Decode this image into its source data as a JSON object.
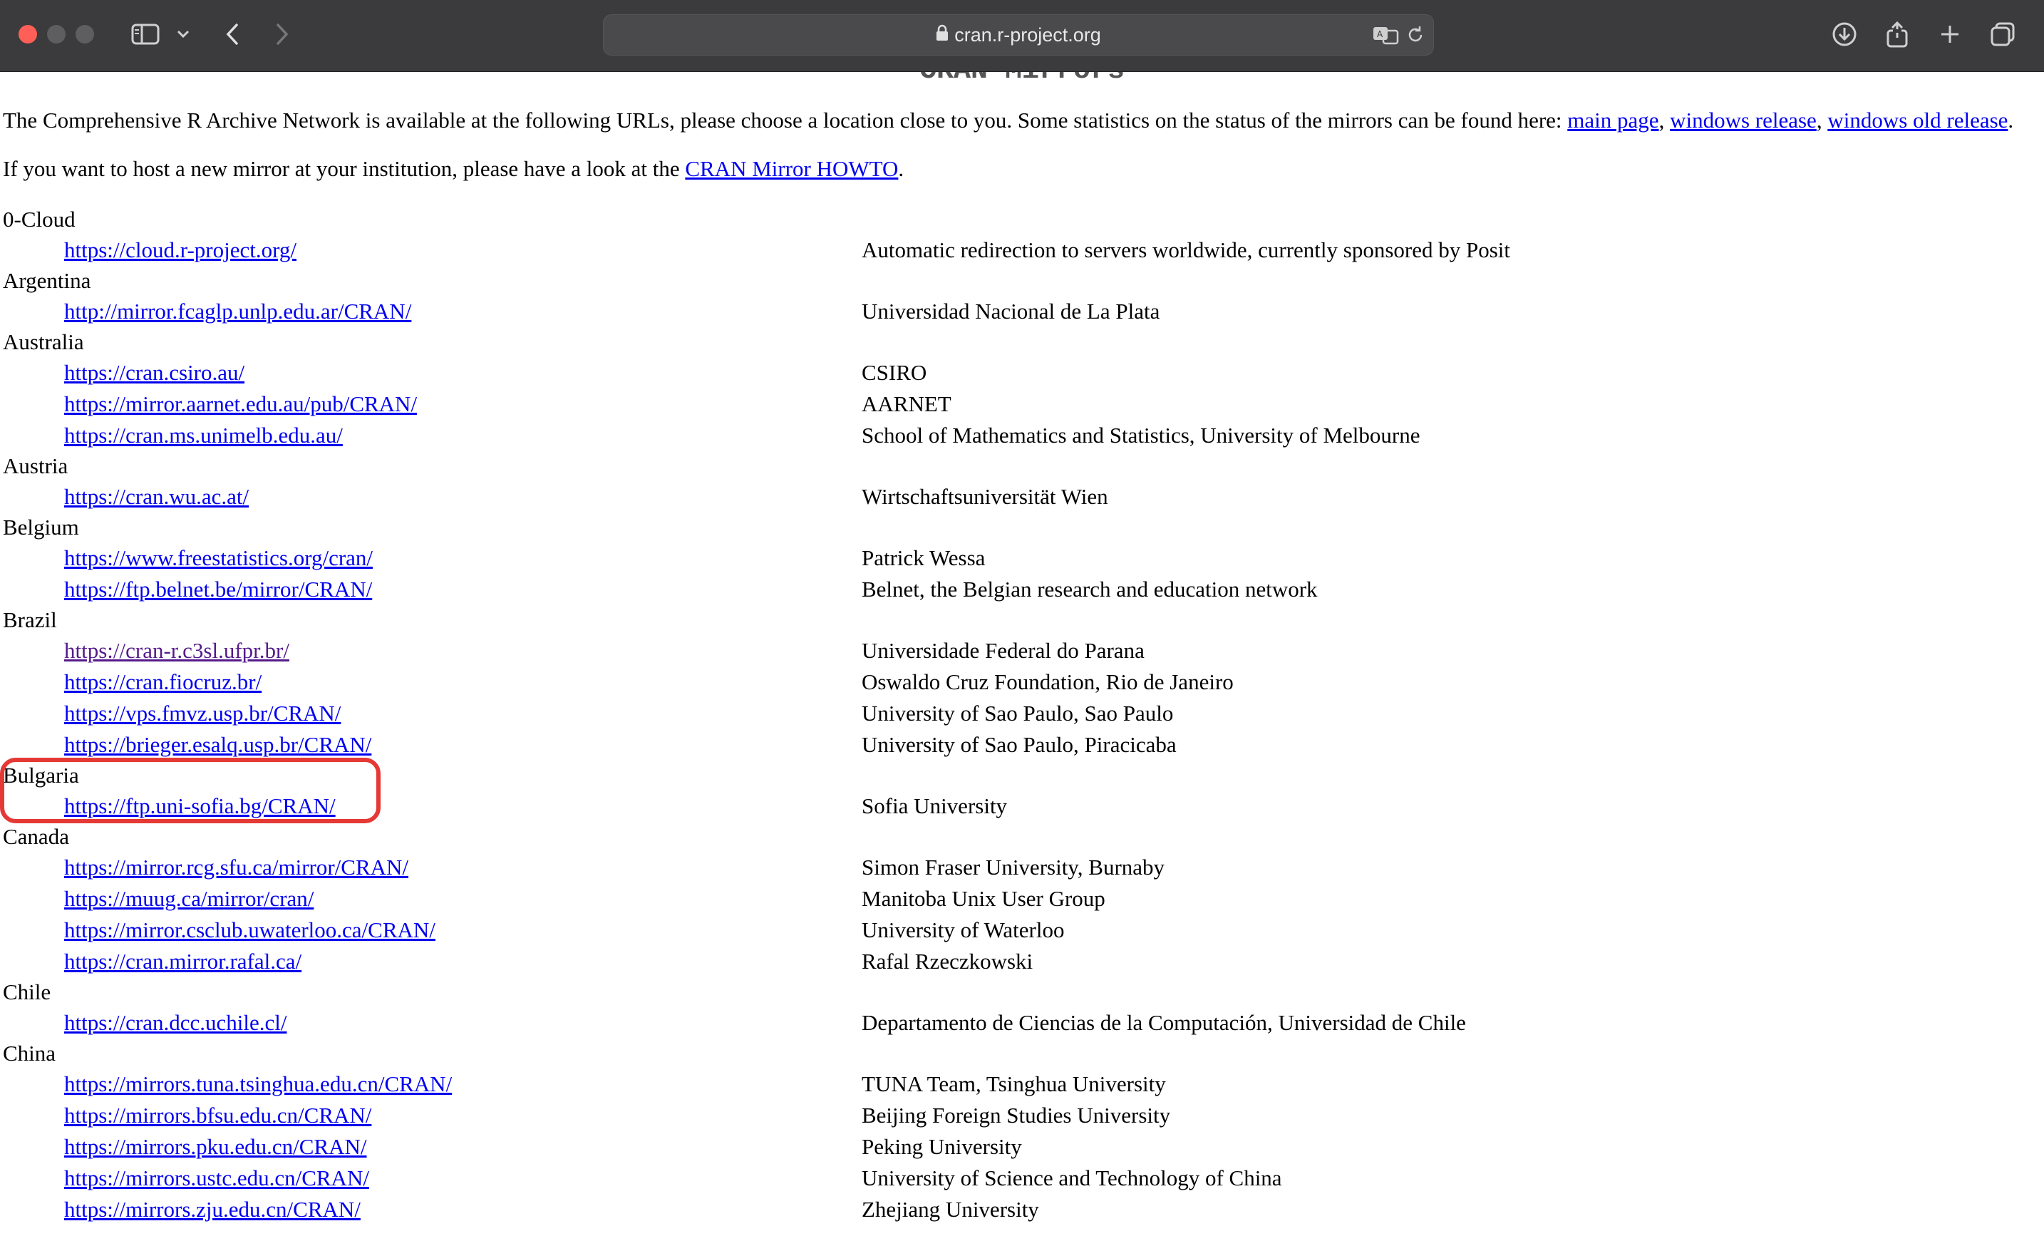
{
  "browser": {
    "url": "cran.r-project.org",
    "icons": [
      "close-dot",
      "minimize-dot",
      "maximize-dot",
      "sidebar-icon",
      "chevron-down-icon",
      "back-icon",
      "forward-icon",
      "lock-icon",
      "translate-icon",
      "reload-icon",
      "download-icon",
      "share-icon",
      "plus-icon",
      "tabs-overview-icon"
    ]
  },
  "page": {
    "title": "CRAN Mirrors",
    "intro": {
      "text": "The Comprehensive R Archive Network is available at the following URLs, please choose a location close to you. Some statistics on the status of the mirrors can be found here: ",
      "link_main": "main page",
      "sep1": ", ",
      "link_windows": "windows release",
      "sep2": ", ",
      "link_windows_old": "windows old release",
      "end": "."
    },
    "host": {
      "text": "If you want to host a new mirror at your institution, please have a look at the ",
      "link": "CRAN Mirror HOWTO",
      "end": "."
    }
  },
  "mirrors": [
    {
      "country": "0-Cloud",
      "entries": [
        {
          "url": "https://cloud.r-project.org/",
          "host": "Automatic redirection to servers worldwide, currently sponsored by Posit"
        }
      ]
    },
    {
      "country": "Argentina",
      "entries": [
        {
          "url": "http://mirror.fcaglp.unlp.edu.ar/CRAN/",
          "host": "Universidad Nacional de La Plata"
        }
      ]
    },
    {
      "country": "Australia",
      "entries": [
        {
          "url": "https://cran.csiro.au/",
          "host": "CSIRO"
        },
        {
          "url": "https://mirror.aarnet.edu.au/pub/CRAN/",
          "host": "AARNET"
        },
        {
          "url": "https://cran.ms.unimelb.edu.au/",
          "host": "School of Mathematics and Statistics, University of Melbourne"
        }
      ]
    },
    {
      "country": "Austria",
      "entries": [
        {
          "url": "https://cran.wu.ac.at/",
          "host": "Wirtschaftsuniversität Wien"
        }
      ]
    },
    {
      "country": "Belgium",
      "entries": [
        {
          "url": "https://www.freestatistics.org/cran/",
          "host": "Patrick Wessa"
        },
        {
          "url": "https://ftp.belnet.be/mirror/CRAN/",
          "host": "Belnet, the Belgian research and education network"
        }
      ]
    },
    {
      "country": "Brazil",
      "entries": [
        {
          "url": "https://cran-r.c3sl.ufpr.br/",
          "host": "Universidade Federal do Parana",
          "visited": true
        },
        {
          "url": "https://cran.fiocruz.br/",
          "host": "Oswaldo Cruz Foundation, Rio de Janeiro"
        },
        {
          "url": "https://vps.fmvz.usp.br/CRAN/",
          "host": "University of Sao Paulo, Sao Paulo"
        },
        {
          "url": "https://brieger.esalq.usp.br/CRAN/",
          "host": "University of Sao Paulo, Piracicaba"
        }
      ]
    },
    {
      "country": "Bulgaria",
      "entries": [
        {
          "url": "https://ftp.uni-sofia.bg/CRAN/",
          "host": "Sofia University"
        }
      ]
    },
    {
      "country": "Canada",
      "entries": [
        {
          "url": "https://mirror.rcg.sfu.ca/mirror/CRAN/",
          "host": "Simon Fraser University, Burnaby"
        },
        {
          "url": "https://muug.ca/mirror/cran/",
          "host": "Manitoba Unix User Group"
        },
        {
          "url": "https://mirror.csclub.uwaterloo.ca/CRAN/",
          "host": "University of Waterloo"
        },
        {
          "url": "https://cran.mirror.rafal.ca/",
          "host": "Rafal Rzeczkowski"
        }
      ]
    },
    {
      "country": "Chile",
      "entries": [
        {
          "url": "https://cran.dcc.uchile.cl/",
          "host": "Departamento de Ciencias de la Computación, Universidad de Chile"
        }
      ]
    },
    {
      "country": "China",
      "entries": [
        {
          "url": "https://mirrors.tuna.tsinghua.edu.cn/CRAN/",
          "host": "TUNA Team, Tsinghua University"
        },
        {
          "url": "https://mirrors.bfsu.edu.cn/CRAN/",
          "host": "Beijing Foreign Studies University"
        },
        {
          "url": "https://mirrors.pku.edu.cn/CRAN/",
          "host": "Peking University"
        },
        {
          "url": "https://mirrors.ustc.edu.cn/CRAN/",
          "host": "University of Science and Technology of China"
        },
        {
          "url": "https://mirrors.zju.edu.cn/CRAN/",
          "host": "Zhejiang University"
        }
      ]
    }
  ],
  "annotation": {
    "color": "#e53935"
  }
}
